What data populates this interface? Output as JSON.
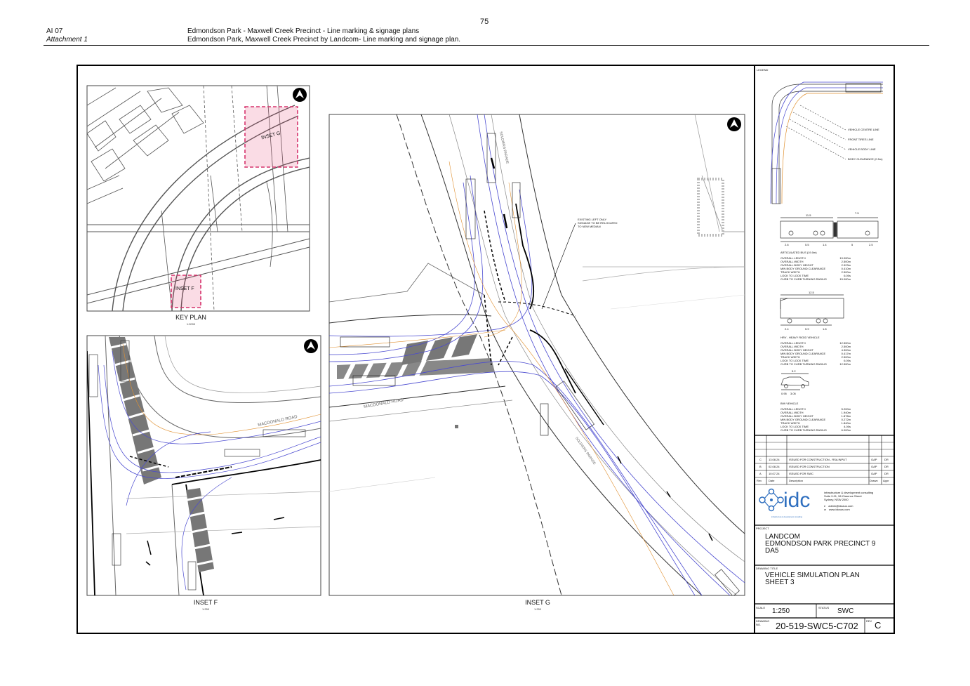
{
  "page_number": "75",
  "header": {
    "left_line1": "AI 07",
    "left_line2": "Attachment 1",
    "right_line1": "Edmondson Park - Maxwell Creek Precinct - Line marking & signage plans",
    "right_line2": "Edmondson Park, Maxwell Creek Precinct by Landcom- Line marking and signage plan."
  },
  "key_plan": {
    "title": "KEY PLAN",
    "scale": "1:2000",
    "inset_g_label": "INSET G",
    "inset_f_label": "INSET F"
  },
  "inset_f": {
    "title": "INSET F",
    "scale": "1:250",
    "road_label": "MACDONALD ROAD"
  },
  "inset_g": {
    "title": "INSET G",
    "scale": "1:250",
    "road_label_1": "MACDONALD ROAD",
    "road_label_2": "SOLDIERS PARADE",
    "road_label_3": "SOLDIERS PARADE",
    "note": [
      "EXISTING LEFT ONLY",
      "SIGNAGE TO BE RELOCATED",
      "TO NEW MEDIAN"
    ]
  },
  "legend": {
    "title": "LEGEND",
    "items": [
      "VEHICLE CENTRE LINE",
      "FRONT TIRES LINE",
      "VEHICLE BODY LINE",
      "BODY CLEARANCE (0.5m)"
    ],
    "vehicles": [
      {
        "name": "ARTICULATED BUS (19.0m)",
        "top_dims": [
          "11.5",
          "7.5"
        ],
        "bottom_dims": [
          "2.6",
          "5.5",
          "1.4",
          "5",
          "2.5"
        ],
        "specs": [
          [
            "OVERALL LENGTH",
            "19.000m"
          ],
          [
            "OVERALL WIDTH",
            "2.500m"
          ],
          [
            "OVERALL BODY HEIGHT",
            "2.923m"
          ],
          [
            "MIN BODY GROUND CLEARANCE",
            "0.410m"
          ],
          [
            "TRACK WIDTH",
            "2.500m"
          ],
          [
            "LOCK TO LOCK TIME",
            "6.00s"
          ],
          [
            "CURB TO CURB TURNING RADIUS",
            "15.000m"
          ]
        ]
      },
      {
        "name": "HRV - HEAVY RIGID VEHICLE",
        "top_dims": [
          "12.5"
        ],
        "bottom_dims": [
          "2.4",
          "5.9",
          "1.8"
        ],
        "specs": [
          [
            "OVERALL LENGTH",
            "12.500m"
          ],
          [
            "OVERALL WIDTH",
            "2.500m"
          ],
          [
            "OVERALL BODY HEIGHT",
            "4.300m"
          ],
          [
            "MIN BODY GROUND CLEARANCE",
            "0.417m"
          ],
          [
            "TRACK WIDTH",
            "2.500m"
          ],
          [
            "LOCK TO LOCK TIME",
            "6.00s"
          ],
          [
            "CURB TO CURB TURNING RADIUS",
            "12.500m"
          ]
        ]
      },
      {
        "name": "B99 VEHICLE",
        "top_dims": [
          "5.2"
        ],
        "bottom_dims": [
          "0.95",
          "3.05"
        ],
        "specs": [
          [
            "OVERALL LENGTH",
            "5.200m"
          ],
          [
            "OVERALL WIDTH",
            "1.940m"
          ],
          [
            "OVERALL BODY HEIGHT",
            "1.878m"
          ],
          [
            "MIN BODY GROUND CLEARANCE",
            "0.272m"
          ],
          [
            "TRACK WIDTH",
            "1.840m"
          ],
          [
            "LOCK TO LOCK TIME",
            "4.00s"
          ],
          [
            "CURB TO CURB TURNING RADIUS",
            "6.000m"
          ]
        ]
      }
    ]
  },
  "revisions": {
    "rows": [
      {
        "rev": "C",
        "date": "13.08.24",
        "desc": "ISSUED FOR CONSTRUCTION - RSA INPUT",
        "drawn": "GAP",
        "appr": "DR"
      },
      {
        "rev": "B",
        "date": "02.08.24",
        "desc": "ISSUED FOR CONSTRUCTION",
        "drawn": "GAP",
        "appr": "DR"
      },
      {
        "rev": "A",
        "date": "10.07.24",
        "desc": "ISSUED FOR SWC",
        "drawn": "GAP",
        "appr": "DR"
      }
    ],
    "headers": {
      "rev": "Rev",
      "date": "Date",
      "desc": "Description",
      "drawn": "Drawn",
      "appr": "Appr"
    }
  },
  "company": {
    "logo_text": "idc",
    "tagline": "infrastructure & development consulting",
    "lines": [
      "infrastructure & development consulting",
      "Suite 9.01, 56 Clarence Street",
      "Sydney, NSW 2000"
    ],
    "email": "admin@idcaus.com",
    "web": "www.idcaus.com"
  },
  "project": {
    "label": "PROJECT",
    "lines": [
      "LANDCOM",
      "EDMONDSON PARK PRECINCT 9",
      "DA5"
    ]
  },
  "drawing_title": {
    "label": "DRAWING TITLE",
    "lines": [
      "VEHICLE SIMULATION PLAN",
      "SHEET 3"
    ]
  },
  "scale": {
    "label": "SCALE",
    "value": "1:250"
  },
  "status": {
    "label": "STATUS",
    "value": "SWC"
  },
  "drawing_no": {
    "label": "DRAWING NO.",
    "value": "20-519-SWC5-C702"
  },
  "rev": {
    "label": "REV",
    "value": "C"
  }
}
